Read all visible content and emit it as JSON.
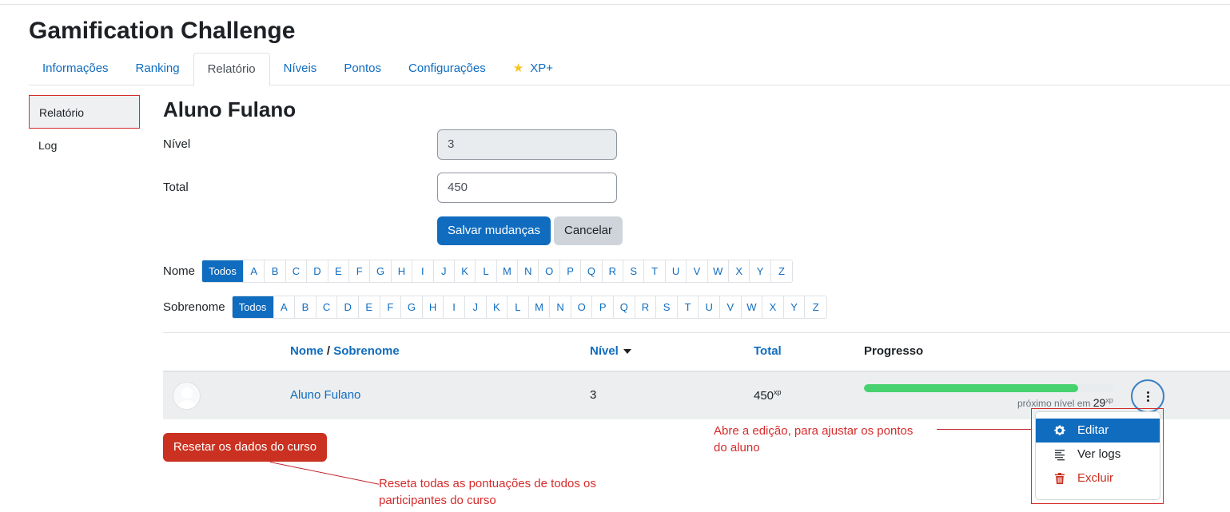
{
  "page_title": "Gamification Challenge",
  "tabs": [
    {
      "label": "Informações"
    },
    {
      "label": "Ranking"
    },
    {
      "label": "Relatório"
    },
    {
      "label": "Níveis"
    },
    {
      "label": "Pontos"
    },
    {
      "label": "Configurações"
    },
    {
      "label": "XP+",
      "icon": "star-icon"
    }
  ],
  "active_tab": "Relatório",
  "sidebar": {
    "items": [
      {
        "label": "Relatório",
        "active": true
      },
      {
        "label": "Log"
      }
    ]
  },
  "form": {
    "student_name": "Aluno Fulano",
    "level_label": "Nível",
    "level_value": "3",
    "total_label": "Total",
    "total_value": "450",
    "save_label": "Salvar mudanças",
    "cancel_label": "Cancelar"
  },
  "filters": {
    "first_name_label": "Nome",
    "last_name_label": "Sobrenome",
    "all_label": "Todos",
    "letters": [
      "A",
      "B",
      "C",
      "D",
      "E",
      "F",
      "G",
      "H",
      "I",
      "J",
      "K",
      "L",
      "M",
      "N",
      "O",
      "P",
      "Q",
      "R",
      "S",
      "T",
      "U",
      "V",
      "W",
      "X",
      "Y",
      "Z"
    ]
  },
  "table": {
    "headers": {
      "name": "Nome",
      "separator": "/",
      "surname": "Sobrenome",
      "level": "Nível",
      "total": "Total",
      "progress": "Progresso"
    },
    "rows": [
      {
        "name": "Aluno Fulano",
        "level": "3",
        "total": "450",
        "total_unit": "xp",
        "progress_fraction": 0.86,
        "next_level_prefix": "próximo nível em",
        "next_level_value": "29",
        "next_level_unit": "xp"
      }
    ]
  },
  "row_menu": {
    "items": [
      {
        "label": "Editar",
        "icon": "gear-icon"
      },
      {
        "label": "Ver logs",
        "icon": "list-icon"
      },
      {
        "label": "Excluir",
        "icon": "trash-icon"
      }
    ]
  },
  "reset_button": "Resetar os dados do curso",
  "annotations": {
    "edit_note_line1": "Abre a edição, para ajustar os pontos",
    "edit_note_line2": "do aluno",
    "reset_note_line1": "Reseta todas as pontuações de todos os",
    "reset_note_line2": "participantes do curso"
  },
  "colors": {
    "primary": "#0f6cbf",
    "danger": "#ca3120",
    "progress": "#47d16f",
    "annotation": "#d52b2b"
  }
}
